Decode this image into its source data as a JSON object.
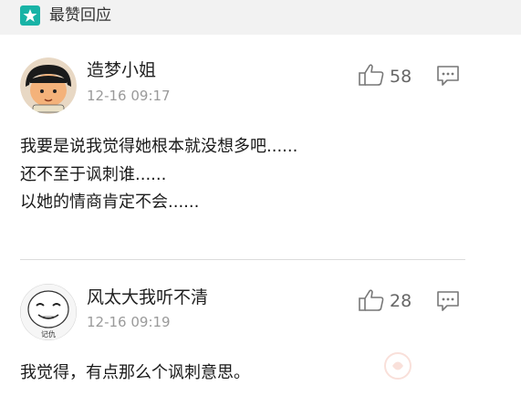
{
  "header": {
    "title": "最赞回应"
  },
  "comments": [
    {
      "username": "造梦小姐",
      "time": "12-16 09:17",
      "likes": "58",
      "lines": [
        "我要是说我觉得她根本就没想多吧......",
        "还不至于讽刺谁......",
        "以她的情商肯定不会......"
      ],
      "avatar_icon": "cartoon-girl-avatar"
    },
    {
      "username": "风太大我听不清",
      "time": "12-16 09:19",
      "likes": "28",
      "lines": [
        "我觉得，有点那么个讽刺意思。"
      ],
      "avatar_icon": "meme-face-avatar"
    }
  ],
  "colors": {
    "accent": "#18b3a6",
    "header_bg": "#f2f2f2",
    "time": "#9a9a9a"
  }
}
